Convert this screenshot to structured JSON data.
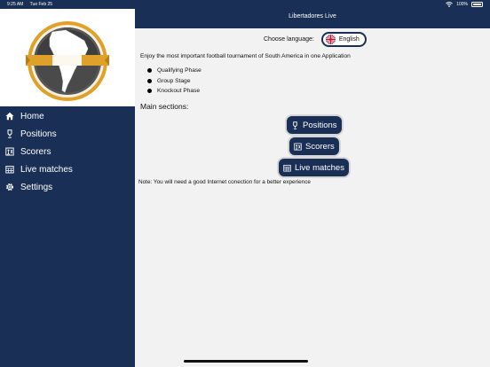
{
  "status_bar": {
    "time": "9:25 AM",
    "date": "Tue Feb 25",
    "battery": "100%"
  },
  "header": {
    "title": "Libertadores Live"
  },
  "sidebar": {
    "items": [
      {
        "label": "Home",
        "icon": "home-icon"
      },
      {
        "label": "Positions",
        "icon": "trophy-icon"
      },
      {
        "label": "Scorers",
        "icon": "scorers-icon"
      },
      {
        "label": "Live matches",
        "icon": "calendar-icon"
      },
      {
        "label": "Settings",
        "icon": "gear-icon"
      }
    ]
  },
  "main": {
    "language_label": "Choose language:",
    "language_value": "English",
    "intro": "Enjoy the most important football tournament of South America in one Application",
    "phases": [
      "Qualifying Phase",
      "Group Stage",
      "Knockout Phase"
    ],
    "sections_label": "Main sections:",
    "buttons": {
      "positions": "Positions",
      "scorers": "Scorers",
      "live": "Live matches"
    },
    "note": "Note: You will need a good Internet conection for a better experience"
  },
  "colors": {
    "navy": "#1a2f55",
    "gold": "#e0a12a",
    "background": "#f2f2f2"
  }
}
